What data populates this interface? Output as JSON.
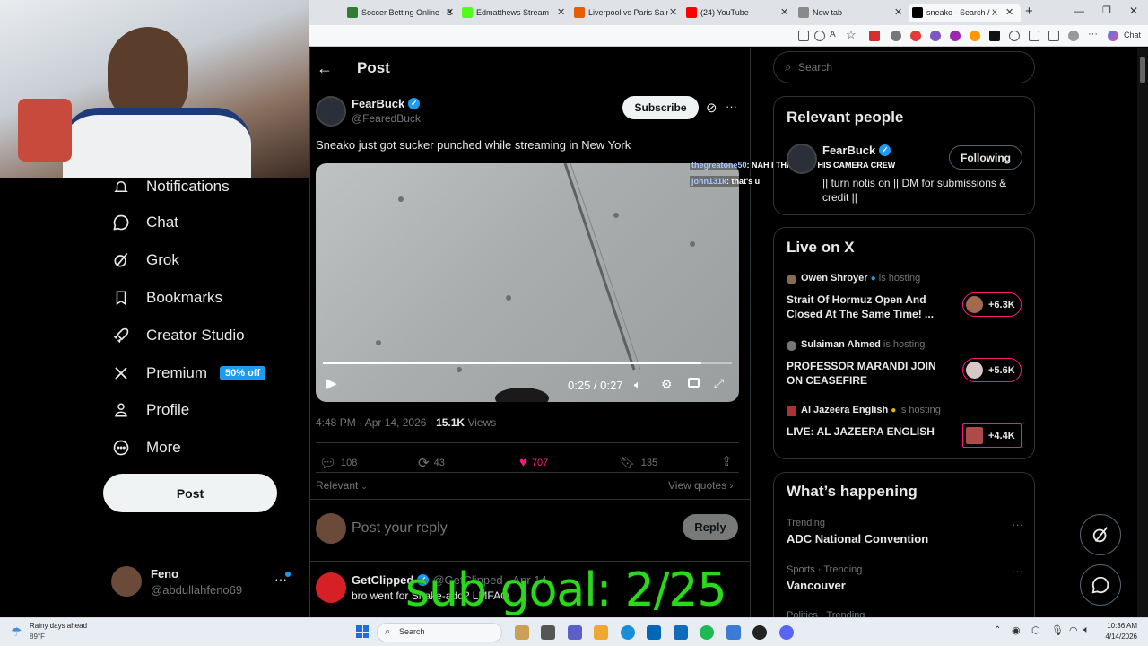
{
  "browser": {
    "tabs": [
      {
        "label": "Soccer Betting Online - B",
        "color": "#2e7d32"
      },
      {
        "label": "Edmatthews Stream",
        "color": "#53fc18"
      },
      {
        "label": "Liverpool vs Paris Saint-G",
        "color": "#e85d04"
      },
      {
        "label": "(24) YouTube",
        "color": "#ff0000"
      },
      {
        "label": "New tab",
        "color": "#8a8a8a"
      },
      {
        "label": "sneako - Search / X",
        "color": "#000000"
      }
    ],
    "new_tab_symbol": "+",
    "chat_label": "Chat"
  },
  "sidebar": {
    "items": [
      {
        "label": "Notifications",
        "icon": "bell-icon"
      },
      {
        "label": "Chat",
        "icon": "chat-icon"
      },
      {
        "label": "Grok",
        "icon": "grok-icon"
      },
      {
        "label": "Bookmarks",
        "icon": "bookmark-icon"
      },
      {
        "label": "Creator Studio",
        "icon": "rocket-icon"
      },
      {
        "label": "Premium",
        "icon": "x-logo-icon",
        "badge": "50% off"
      },
      {
        "label": "Profile",
        "icon": "person-icon"
      },
      {
        "label": "More",
        "icon": "more-circle-icon"
      }
    ],
    "post_button": "Post",
    "account": {
      "name": "Feno",
      "handle": "@abdullahfeno69"
    }
  },
  "main": {
    "header_title": "Post",
    "author": {
      "name": "FearBuck",
      "handle": "@FearedBuck"
    },
    "subscribe_label": "Subscribe",
    "post_text": "Sneako just got sucker punched while streaming in New York",
    "video": {
      "time": "0:25 / 0:27",
      "progress": 0.926
    },
    "chat_overlay": [
      {
        "user": "thegreatone50",
        "message": ": NAH I THINK ITS HIS CAMERA CREW"
      },
      {
        "user": "john131k",
        "message": ": that's u"
      }
    ],
    "meta": {
      "time": "4:48 PM · Apr 14, 2026 · ",
      "views": "15.1K",
      "views_label": " Views"
    },
    "actions": {
      "replies": "108",
      "reposts": "43",
      "likes": "707",
      "bookmarks": "135"
    },
    "sort_label": "Relevant",
    "view_quotes": "View quotes",
    "reply_placeholder": "Post your reply",
    "reply_button": "Reply",
    "reply": {
      "name": "GetClipped",
      "handle": "@GetClipped · Apr 14",
      "text": "bro went for Shake-ado? LMFAO"
    }
  },
  "right": {
    "search_placeholder": "Search",
    "relevant_title": "Relevant people",
    "relevant": {
      "name": "FearBuck",
      "follow_label": "Following",
      "bio": "|| turn notis on || DM for submissions & credit ||"
    },
    "live_title": "Live on X",
    "live": [
      {
        "host": "Owen Shroyer",
        "hosting": "is hosting",
        "title": "Strait Of Hormuz Open And Closed At The Same Time! ...",
        "count": "+6.3K"
      },
      {
        "host": "Sulaiman Ahmed",
        "hosting": "is hosting",
        "title": "PROFESSOR MARANDI JOIN ON CEASEFIRE",
        "count": "+5.6K"
      },
      {
        "host": "Al Jazeera English",
        "hosting": "is hosting",
        "title": "LIVE: AL JAZEERA ENGLISH",
        "count": "+4.4K"
      }
    ],
    "happening_title": "What’s happening",
    "trends": [
      {
        "context": "Trending",
        "title": "ADC National Convention"
      },
      {
        "context": "Sports · Trending",
        "title": "Vancouver"
      },
      {
        "context": "Politics · Trending",
        "title": ""
      }
    ]
  },
  "overlay": {
    "sub_goal": "sub goal: 2/25"
  },
  "taskbar": {
    "weather_title": "Rainy days ahead",
    "weather_temp": "89°F",
    "search_label": "Search",
    "time": "10:36 AM",
    "date": "4/14/2026"
  }
}
